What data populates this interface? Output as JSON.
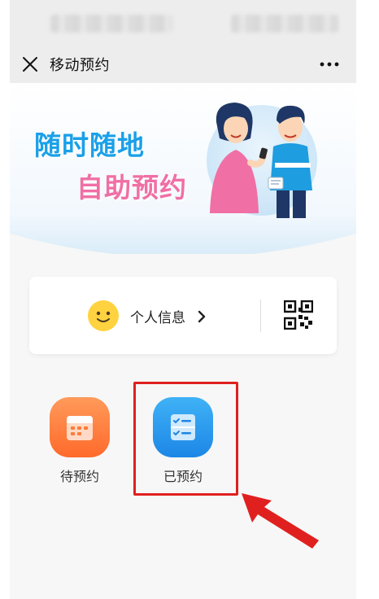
{
  "nav": {
    "title": "移动预约"
  },
  "banner": {
    "line1": "随时随地",
    "line2": "自助预约"
  },
  "info_card": {
    "label": "个人信息"
  },
  "tiles": [
    {
      "label": "待预约",
      "icon": "calendar-icon"
    },
    {
      "label": "已预约",
      "icon": "checklist-icon"
    }
  ],
  "colors": {
    "slogan_blue": "#1aa0e8",
    "slogan_pink": "#f06fa5",
    "tile_orange": "#ff7c3a",
    "tile_blue": "#1f8de8",
    "highlight_red": "#e0201f"
  }
}
